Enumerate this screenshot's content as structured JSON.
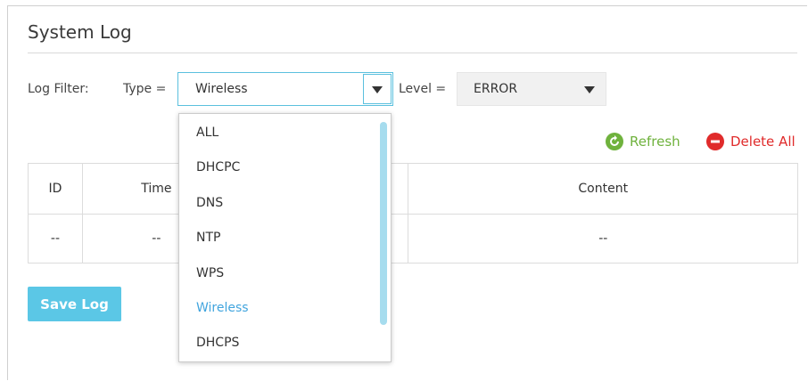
{
  "page": {
    "title": "System Log"
  },
  "filter": {
    "label": "Log Filter:",
    "type_label": "Type =",
    "type_value": "Wireless",
    "level_label": "Level =",
    "level_value": "ERROR"
  },
  "actions": {
    "refresh": "Refresh",
    "delete_all": "Delete All"
  },
  "table": {
    "headers": [
      "ID",
      "Time",
      "",
      "Content"
    ],
    "rows": [
      [
        "--",
        "--",
        "",
        "--"
      ]
    ]
  },
  "save_button": "Save Log",
  "dropdown": {
    "options": [
      "ALL",
      "DHCPC",
      "DNS",
      "NTP",
      "WPS",
      "Wireless",
      "DHCPS"
    ],
    "selected": "Wireless"
  },
  "colors": {
    "accent": "#5bc0de",
    "selected_option": "#42a5de",
    "refresh": "#6fb23d",
    "delete": "#e02b2b",
    "save_button": "#5bc7e6"
  },
  "icons": {
    "refresh": "refresh-circle-icon",
    "delete": "minus-circle-icon",
    "dropdown": "caret-down-icon"
  }
}
